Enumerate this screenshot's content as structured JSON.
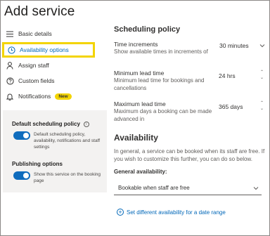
{
  "page": {
    "title": "Add service"
  },
  "nav": {
    "items": [
      {
        "label": "Basic details",
        "icon": "list-icon"
      },
      {
        "label": "Availability options",
        "icon": "clock-icon",
        "active": true
      },
      {
        "label": "Assign staff",
        "icon": "person-icon"
      },
      {
        "label": "Custom fields",
        "icon": "question-icon"
      },
      {
        "label": "Notifications",
        "icon": "bell-icon",
        "badge": "New"
      }
    ]
  },
  "left_panel": {
    "default_policy": {
      "title": "Default scheduling policy",
      "toggle_on": true,
      "desc": "Default scheduling policy, availability, notifications and staff settings"
    },
    "publishing": {
      "title": "Publishing options",
      "toggle_on": true,
      "desc": "Show this service on the booking page"
    }
  },
  "scheduling": {
    "title": "Scheduling policy",
    "time_increments": {
      "label": "Time increments",
      "sub": "Show available times in increments of",
      "value": "30 minutes"
    },
    "min_lead": {
      "label": "Minimum lead time",
      "sub": "Minimum lead time for bookings and cancellations",
      "value": "24 hrs"
    },
    "max_lead": {
      "label": "Maximum lead time",
      "sub": "Maximum days a booking can be made advanced in",
      "value": "365 days"
    }
  },
  "availability": {
    "title": "Availability",
    "text": "In general, a service can be booked when its staff are free. If you wish to customize this further, you can do so below.",
    "general_label": "General availability:",
    "general_value": "Bookable when staff are free",
    "link": "Set different availability for a date range"
  },
  "colors": {
    "accent": "#0067b8",
    "highlight": "#f3d400",
    "toggle": "#0f6cbd"
  }
}
